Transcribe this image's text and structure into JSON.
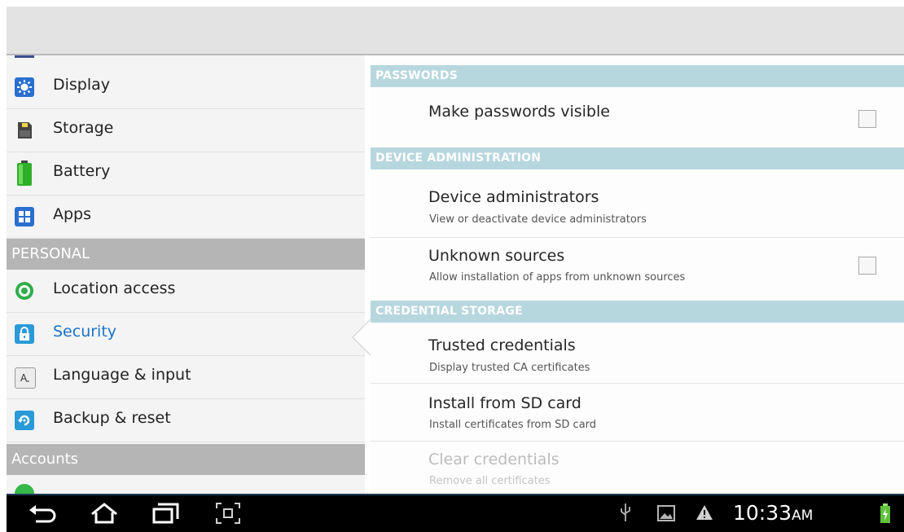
{
  "settings_list": {
    "items": [
      {
        "label": "Display",
        "icon": "display-icon"
      },
      {
        "label": "Storage",
        "icon": "storage-icon"
      },
      {
        "label": "Battery",
        "icon": "battery-icon"
      },
      {
        "label": "Apps",
        "icon": "apps-icon"
      }
    ],
    "personal_header": "PERSONAL",
    "personal_items": [
      {
        "label": "Location access",
        "icon": "location-icon"
      },
      {
        "label": "Security",
        "icon": "lock-icon",
        "selected": true
      },
      {
        "label": "Language & input",
        "icon": "keyboard-icon"
      },
      {
        "label": "Backup & reset",
        "icon": "backup-icon"
      }
    ],
    "accounts_header": "Accounts"
  },
  "security": {
    "passwords_header": "PASSWORDS",
    "make_passwords_visible": {
      "title": "Make passwords visible",
      "checked": false
    },
    "device_admin_header": "DEVICE ADMINISTRATION",
    "device_administrators": {
      "title": "Device administrators",
      "summary": "View or deactivate device administrators"
    },
    "unknown_sources": {
      "title": "Unknown sources",
      "summary": "Allow installation of apps from unknown sources",
      "checked": false
    },
    "credential_header": "CREDENTIAL STORAGE",
    "trusted_credentials": {
      "title": "Trusted credentials",
      "summary": "Display trusted CA certificates"
    },
    "install_sd": {
      "title": "Install from SD card",
      "summary": "Install certificates from SD card"
    },
    "clear_credentials": {
      "title": "Clear credentials",
      "summary": "Remove all certificates",
      "enabled": false
    }
  },
  "status_bar": {
    "time": "10:33",
    "ampm": "AM",
    "icons": [
      "usb-icon",
      "gallery-icon",
      "warning-icon",
      "battery-charging-icon"
    ]
  },
  "nav_buttons": [
    "back-icon",
    "home-icon",
    "recent-apps-icon",
    "screenshot-icon"
  ],
  "colors": {
    "section_header": "#b7d7df",
    "left_header": "#b5b5b5",
    "selected_text": "#1a73c8",
    "nav_background": "#000000"
  }
}
